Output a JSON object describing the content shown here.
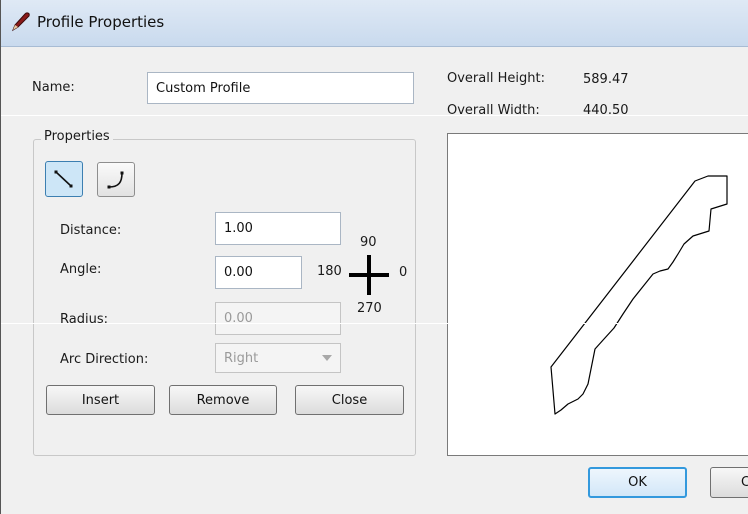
{
  "window": {
    "title": "Profile Properties"
  },
  "name_field": {
    "label": "Name:",
    "value": "Custom Profile"
  },
  "overall": {
    "height_label": "Overall Height:",
    "height_value": "589.47",
    "width_label": "Overall Width:",
    "width_value": "440.50"
  },
  "properties": {
    "group_label": "Properties",
    "line_tool": "line-segment-icon",
    "arc_tool": "arc-segment-icon",
    "distance_label": "Distance:",
    "distance_value": "1.00",
    "angle_label": "Angle:",
    "angle_value": "0.00",
    "radius_label": "Radius:",
    "radius_value": "0.00",
    "arc_direction_label": "Arc Direction:",
    "arc_direction_value": "Right",
    "compass": {
      "top": "90",
      "left": "180",
      "right": "0",
      "bottom": "270"
    },
    "insert_label": "Insert",
    "remove_label": "Remove",
    "close_label": "Close"
  },
  "footer": {
    "ok_label": "OK",
    "cancel_label": "C"
  },
  "colors": {
    "accent": "#3399dd",
    "titlebar": "#c9daee"
  }
}
